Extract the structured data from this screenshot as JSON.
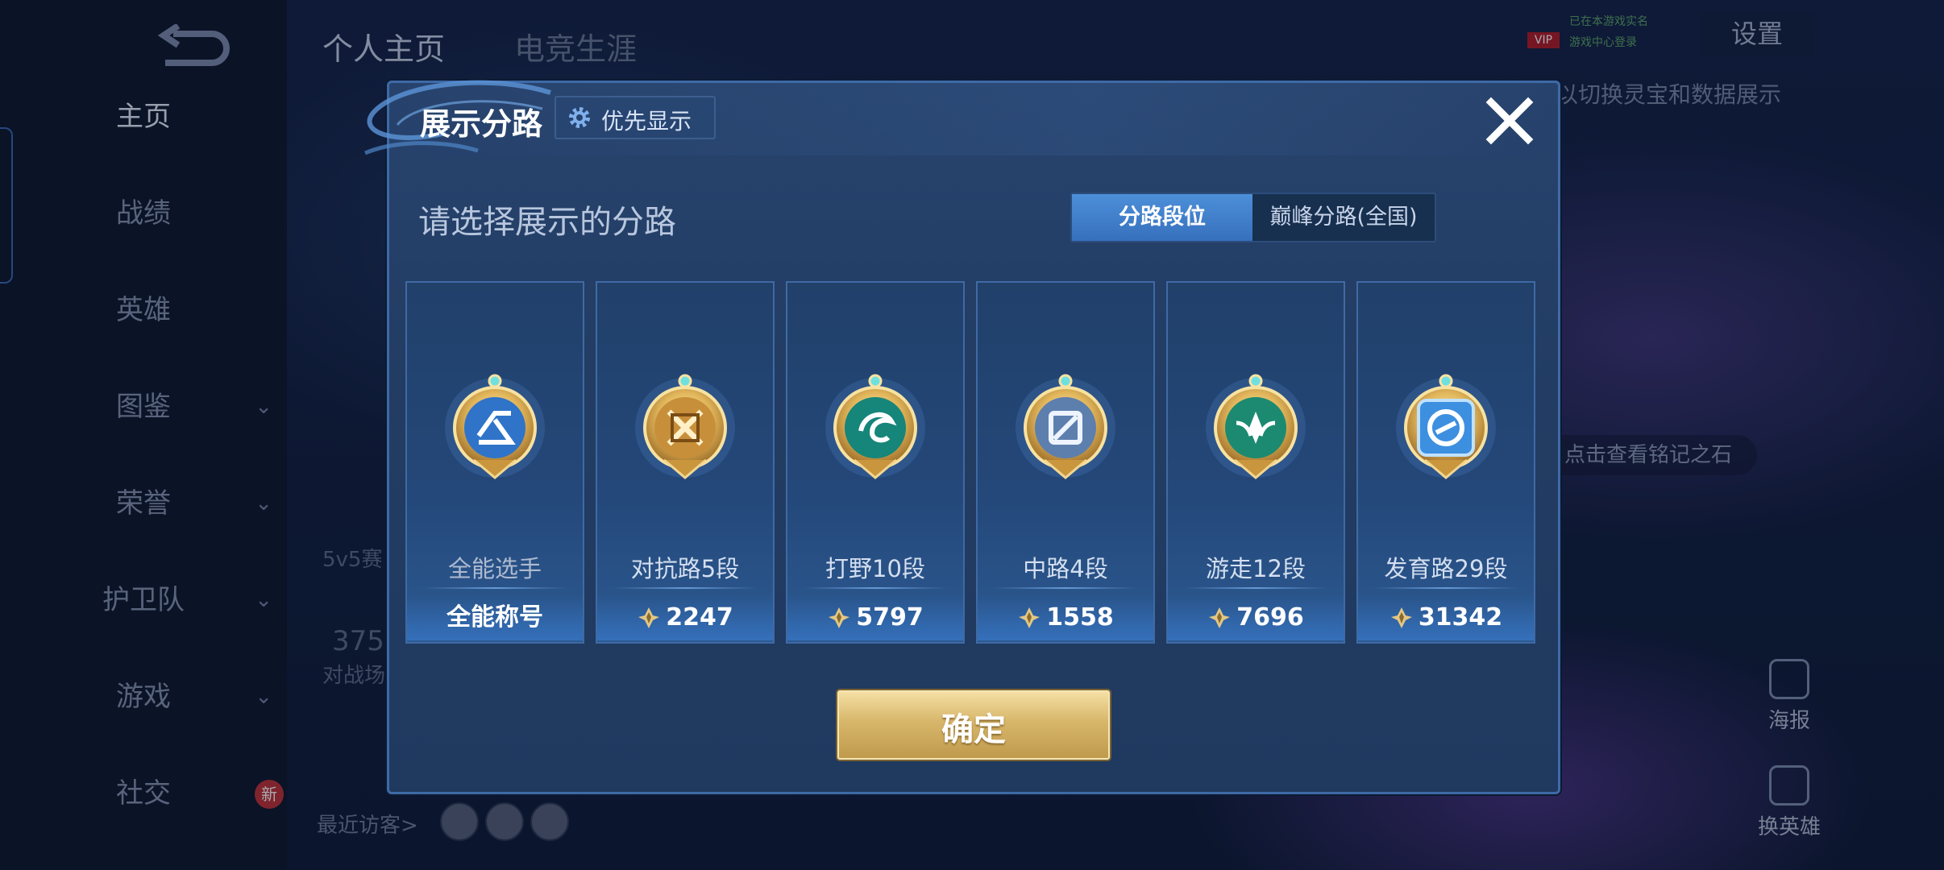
{
  "app": {
    "window_size_note": ""
  },
  "nav": {
    "items": [
      {
        "label": "主页",
        "has_chevron": false,
        "active": true
      },
      {
        "label": "战绩",
        "has_chevron": false
      },
      {
        "label": "英雄",
        "has_chevron": false
      },
      {
        "label": "图鉴",
        "has_chevron": true
      },
      {
        "label": "荣誉",
        "has_chevron": true
      },
      {
        "label": "护卫队",
        "has_chevron": true
      },
      {
        "label": "游戏",
        "has_chevron": true
      },
      {
        "label": "社交",
        "has_chevron": true
      }
    ],
    "new_badge": "新",
    "chevron_glyph": "⌄"
  },
  "topbar": {
    "tabs": [
      "个人主页",
      "电竞生涯"
    ],
    "settings_label": "设置",
    "vip_label": "VIP",
    "vip_line1": "已在本游戏实名",
    "vip_line2": "游戏中心登录",
    "hint": "以切换灵宝和数据展示"
  },
  "background": {
    "stone_button": "点击查看铭记之石",
    "poster_label": "海报",
    "switch_hero_label": "换英雄",
    "recent_visitors": "最近访客>",
    "mode_label": "5v5赛",
    "count": "375",
    "count_sub": "对战场"
  },
  "modal": {
    "title": "展示分路",
    "priority_button": "优先显示",
    "subtitle": "请选择展示的分路",
    "toggle": {
      "active": "分路段位",
      "inactive": "巅峰分路(全国)"
    },
    "cards": [
      {
        "rank": "全能选手",
        "score": "全能称号",
        "emblem": "allround-emblem-icon",
        "has_score_icon": false
      },
      {
        "rank": "对抗路5段",
        "score": "2247",
        "emblem": "clash-lane-emblem-icon",
        "has_score_icon": true
      },
      {
        "rank": "打野10段",
        "score": "5797",
        "emblem": "jungle-emblem-icon",
        "has_score_icon": true
      },
      {
        "rank": "中路4段",
        "score": "1558",
        "emblem": "mid-lane-emblem-icon",
        "has_score_icon": true
      },
      {
        "rank": "游走12段",
        "score": "7696",
        "emblem": "roam-emblem-icon",
        "has_score_icon": true
      },
      {
        "rank": "发育路29段",
        "score": "31342",
        "emblem": "farm-lane-emblem-icon",
        "has_score_icon": true
      }
    ],
    "confirm": "确定"
  },
  "colors": {
    "accent_blue": "#3670bd",
    "gold": "#d7b66a",
    "modal_bg": "#223c63"
  }
}
